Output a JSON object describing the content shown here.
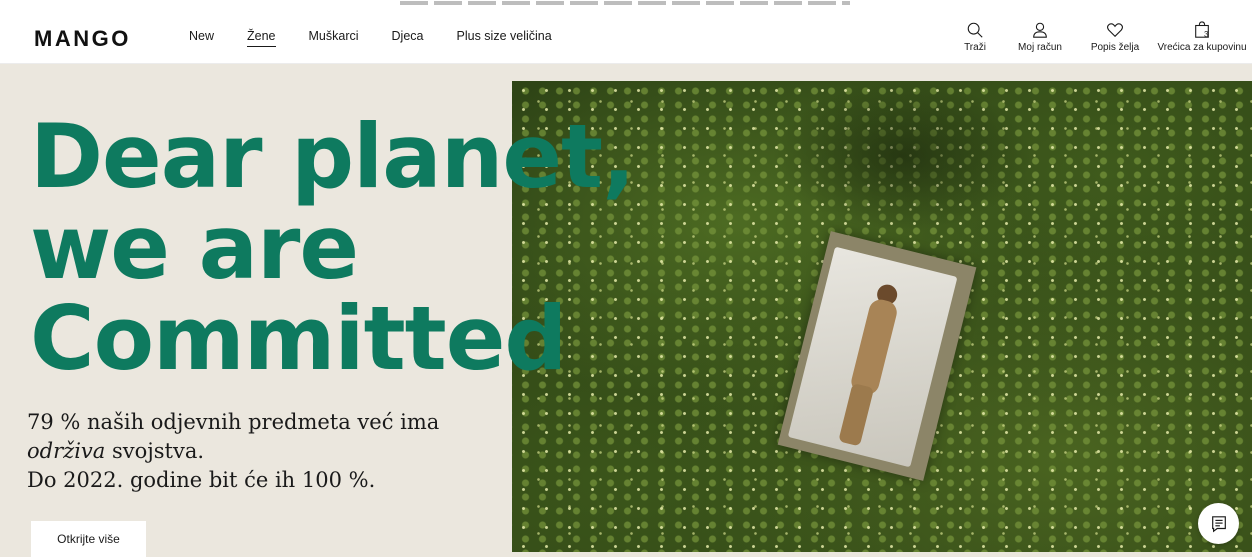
{
  "brand": {
    "logo": "MANGO"
  },
  "nav": {
    "items": [
      {
        "label": "New",
        "active": false
      },
      {
        "label": "Žene",
        "active": true
      },
      {
        "label": "Muškarci",
        "active": false
      },
      {
        "label": "Djeca",
        "active": false
      },
      {
        "label": "Plus size veličina",
        "active": false
      }
    ]
  },
  "tools": {
    "search": {
      "label": "Traži",
      "icon": "search-icon"
    },
    "account": {
      "label": "Moj račun",
      "icon": "user-icon"
    },
    "wishlist": {
      "label": "Popis želja",
      "icon": "heart-icon"
    },
    "bag": {
      "label": "Vrećica za kupovinu",
      "count": "3",
      "icon": "bag-icon"
    }
  },
  "hero": {
    "headline_1": "Dear planet,",
    "headline_2": "we are",
    "headline_3": "Committed",
    "sub_1": "79 % naših odjevnih predmeta već ima",
    "sub_2_italic": "održiva",
    "sub_2_rest": " svojstva.",
    "sub_3": "Do 2022. godine bit će ih 100 %.",
    "cta_label": "Otkrijte više"
  },
  "chat": {
    "icon": "chat-icon"
  },
  "colors": {
    "accent_green": "#0e7a5f",
    "hero_background": "#ebe7de",
    "header_background": "#ffffff"
  }
}
